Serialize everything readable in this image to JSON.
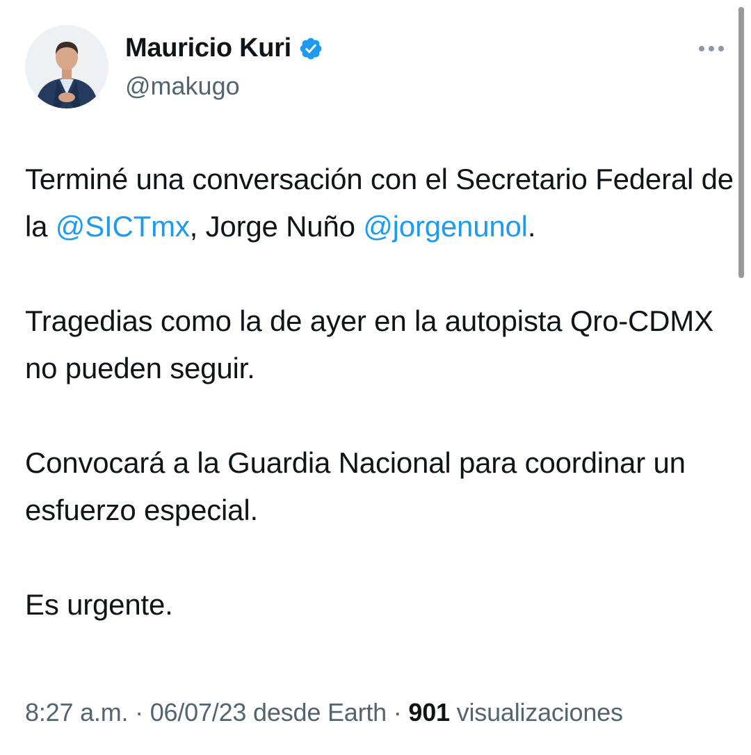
{
  "author": {
    "name": "Mauricio Kuri",
    "handle": "@makugo",
    "verified_color": "#1d9bf0"
  },
  "tweet": {
    "p1_pre": "Terminé una conversación con el Secretario Federal de la ",
    "p1_mention1": "@SICTmx",
    "p1_mid": ", Jorge Nuño ",
    "p1_mention2": "@jorgenunol",
    "p1_end": ".",
    "p2": "Tragedias como la de ayer en la autopista Qro-CDMX no pueden seguir.",
    "p3": "Convocará a la Guardia Nacional para coordinar un esfuerzo especial.",
    "p4": "Es urgente."
  },
  "meta": {
    "time": "8:27 a.m.",
    "sep1": " · ",
    "date": "06/07/23",
    "source": " desde Earth",
    "sep2": " · ",
    "views_count": "901",
    "views_label": " visualizaciones"
  },
  "colors": {
    "link": "#1d9bf0",
    "secondary_text": "#536471",
    "primary_text": "#0f1419"
  },
  "icons": {
    "verified": "verified-badge-icon",
    "more": "more-options-icon"
  }
}
